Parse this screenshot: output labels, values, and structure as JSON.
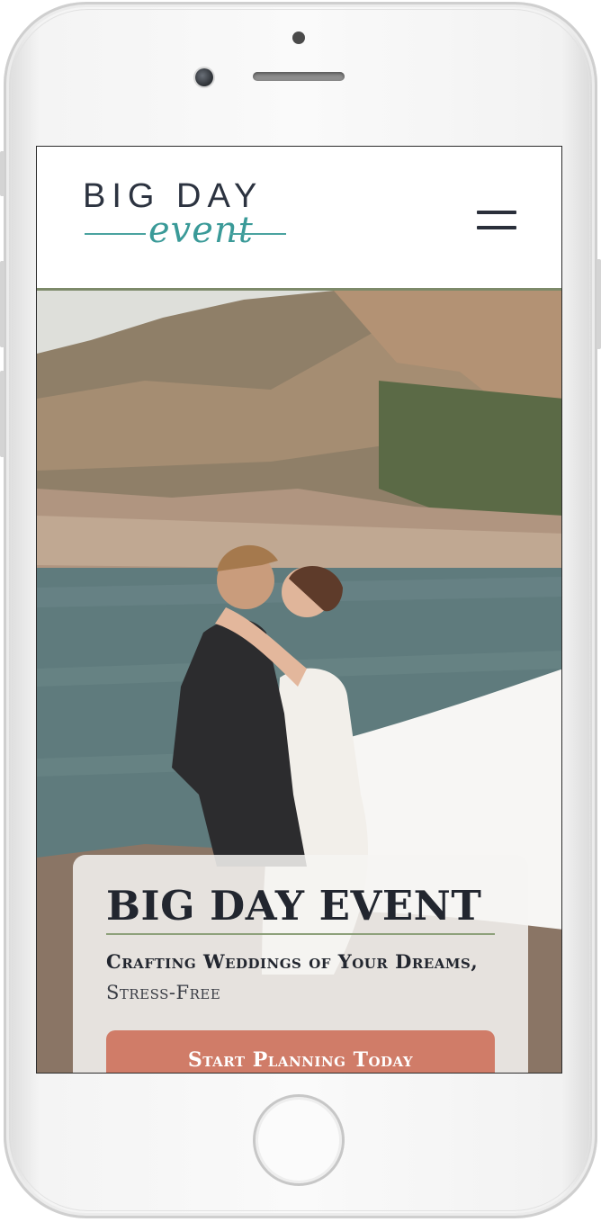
{
  "header": {
    "logo_main": "BIG DAY",
    "logo_script": "event",
    "menu_icon": "hamburger-icon"
  },
  "hero": {
    "title": "BIG DAY EVENT",
    "subtitle_bold": "Crafting Weddings of Your Dreams,",
    "subtitle_light": "Stress-Free",
    "cta_label": "Start Planning Today"
  },
  "colors": {
    "accent_teal": "#3a9a98",
    "header_border": "#7d8a6a",
    "cta_background": "#d07c68",
    "text_dark": "#22262f"
  }
}
